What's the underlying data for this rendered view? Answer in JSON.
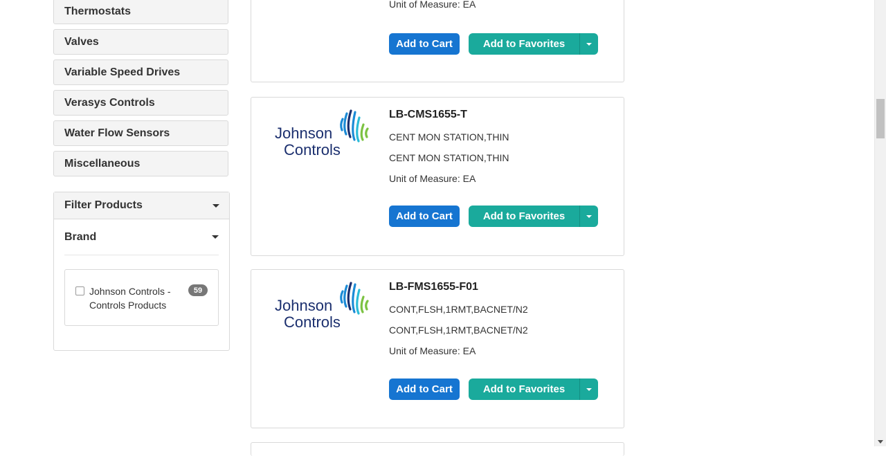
{
  "categories": [
    {
      "label": "Thermostats"
    },
    {
      "label": "Valves"
    },
    {
      "label": "Variable Speed Drives"
    },
    {
      "label": "Verasys Controls"
    },
    {
      "label": "Water Flow Sensors"
    },
    {
      "label": "Miscellaneous"
    }
  ],
  "filter": {
    "title": "Filter Products",
    "brand_title": "Brand",
    "brand_option": {
      "label": "Johnson Controls - Controls Products",
      "count": "59",
      "checked": false
    }
  },
  "products": [
    {
      "sku": "",
      "desc1": "",
      "desc2": "",
      "uom": "Unit of Measure: EA",
      "brand": "Johnson Controls"
    },
    {
      "sku": "LB-CMS1655-T",
      "desc1": "CENT MON STATION,THIN",
      "desc2": "CENT MON STATION,THIN",
      "uom": "Unit of Measure: EA",
      "brand": "Johnson Controls"
    },
    {
      "sku": "LB-FMS1655-F01",
      "desc1": "CONT,FLSH,1RMT,BACNET/N2",
      "desc2": "CONT,FLSH,1RMT,BACNET/N2",
      "uom": "Unit of Measure: EA",
      "brand": "Johnson Controls"
    }
  ],
  "buttons": {
    "add_to_cart": "Add to Cart",
    "add_to_favorites": "Add to Favorites"
  },
  "logo_text": {
    "line1": "Johnson",
    "line2": "Controls"
  },
  "colors": {
    "cart_blue": "#1675d1",
    "favorites_teal": "#1aaa9c",
    "logo_navy": "#1b2f6e"
  }
}
